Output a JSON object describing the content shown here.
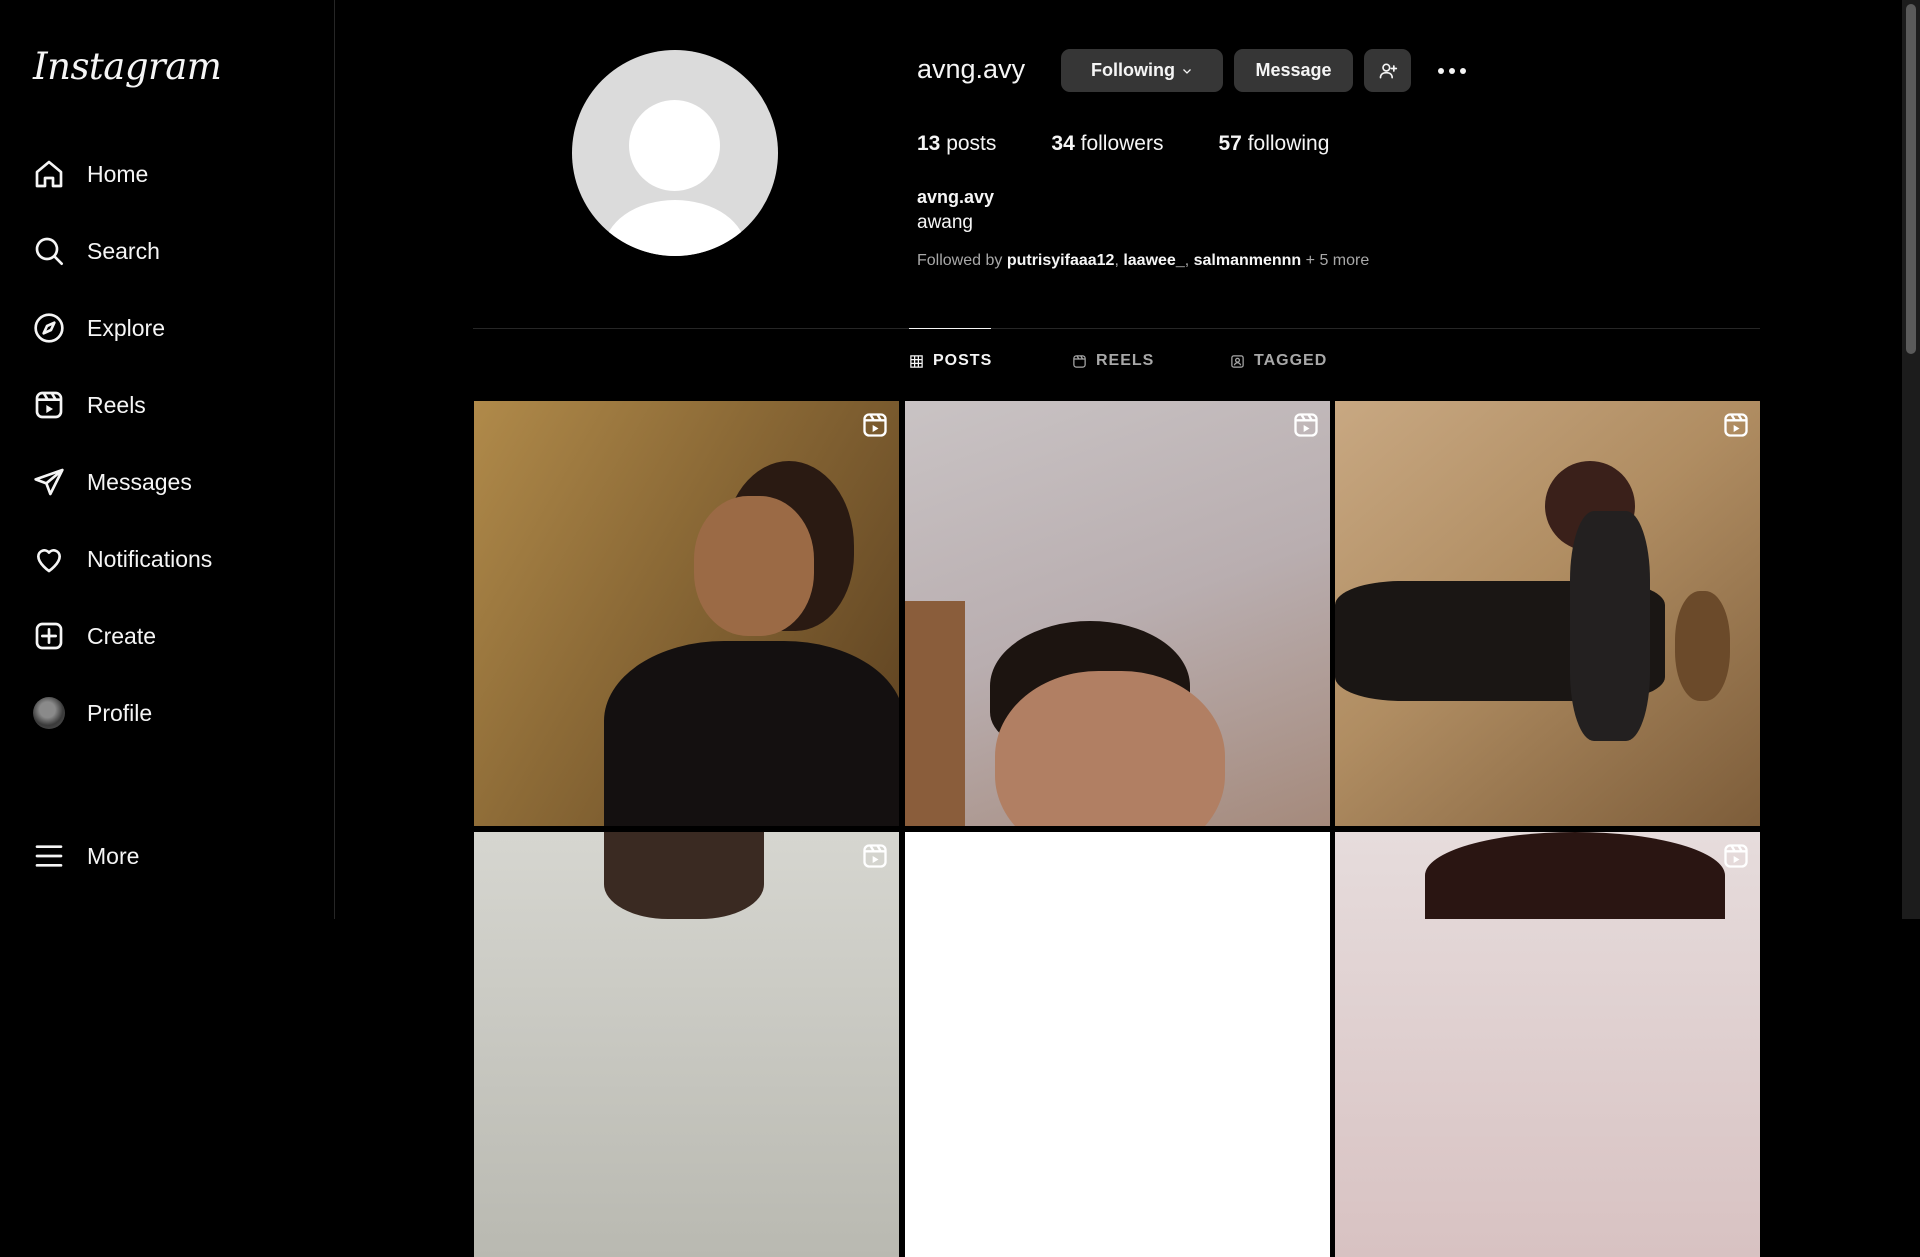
{
  "sidebar": {
    "logo": "Instagram",
    "items": [
      {
        "label": "Home",
        "icon": "home-icon"
      },
      {
        "label": "Search",
        "icon": "search-icon"
      },
      {
        "label": "Explore",
        "icon": "compass-icon"
      },
      {
        "label": "Reels",
        "icon": "reels-icon"
      },
      {
        "label": "Messages",
        "icon": "send-icon"
      },
      {
        "label": "Notifications",
        "icon": "heart-icon"
      },
      {
        "label": "Create",
        "icon": "plus-square-icon"
      },
      {
        "label": "Profile",
        "icon": "avatar"
      },
      {
        "label": "More",
        "icon": "menu-icon"
      }
    ]
  },
  "profile": {
    "username": "avng.avy",
    "following_button": "Following",
    "message_button": "Message",
    "stats": {
      "posts_count": "13",
      "posts_label": "posts",
      "followers_count": "34",
      "followers_label": "followers",
      "following_count": "57",
      "following_label": "following"
    },
    "name": "avng.avy",
    "bio": "awang",
    "followed_by": {
      "prefix": "Followed by ",
      "names": [
        "putrisyifaaa12",
        "laawee_",
        "salmanmennn"
      ],
      "suffix": " + 5 more"
    }
  },
  "tabs": [
    {
      "label": "POSTS",
      "icon": "grid-icon",
      "active": true
    },
    {
      "label": "REELS",
      "icon": "reels-icon",
      "active": false
    },
    {
      "label": "TAGGED",
      "icon": "tagged-icon",
      "active": false
    }
  ],
  "posts": [
    {
      "type": "reel"
    },
    {
      "type": "reel"
    },
    {
      "type": "reel"
    },
    {
      "type": "reel"
    },
    {
      "type": "image"
    },
    {
      "type": "reel"
    }
  ]
}
